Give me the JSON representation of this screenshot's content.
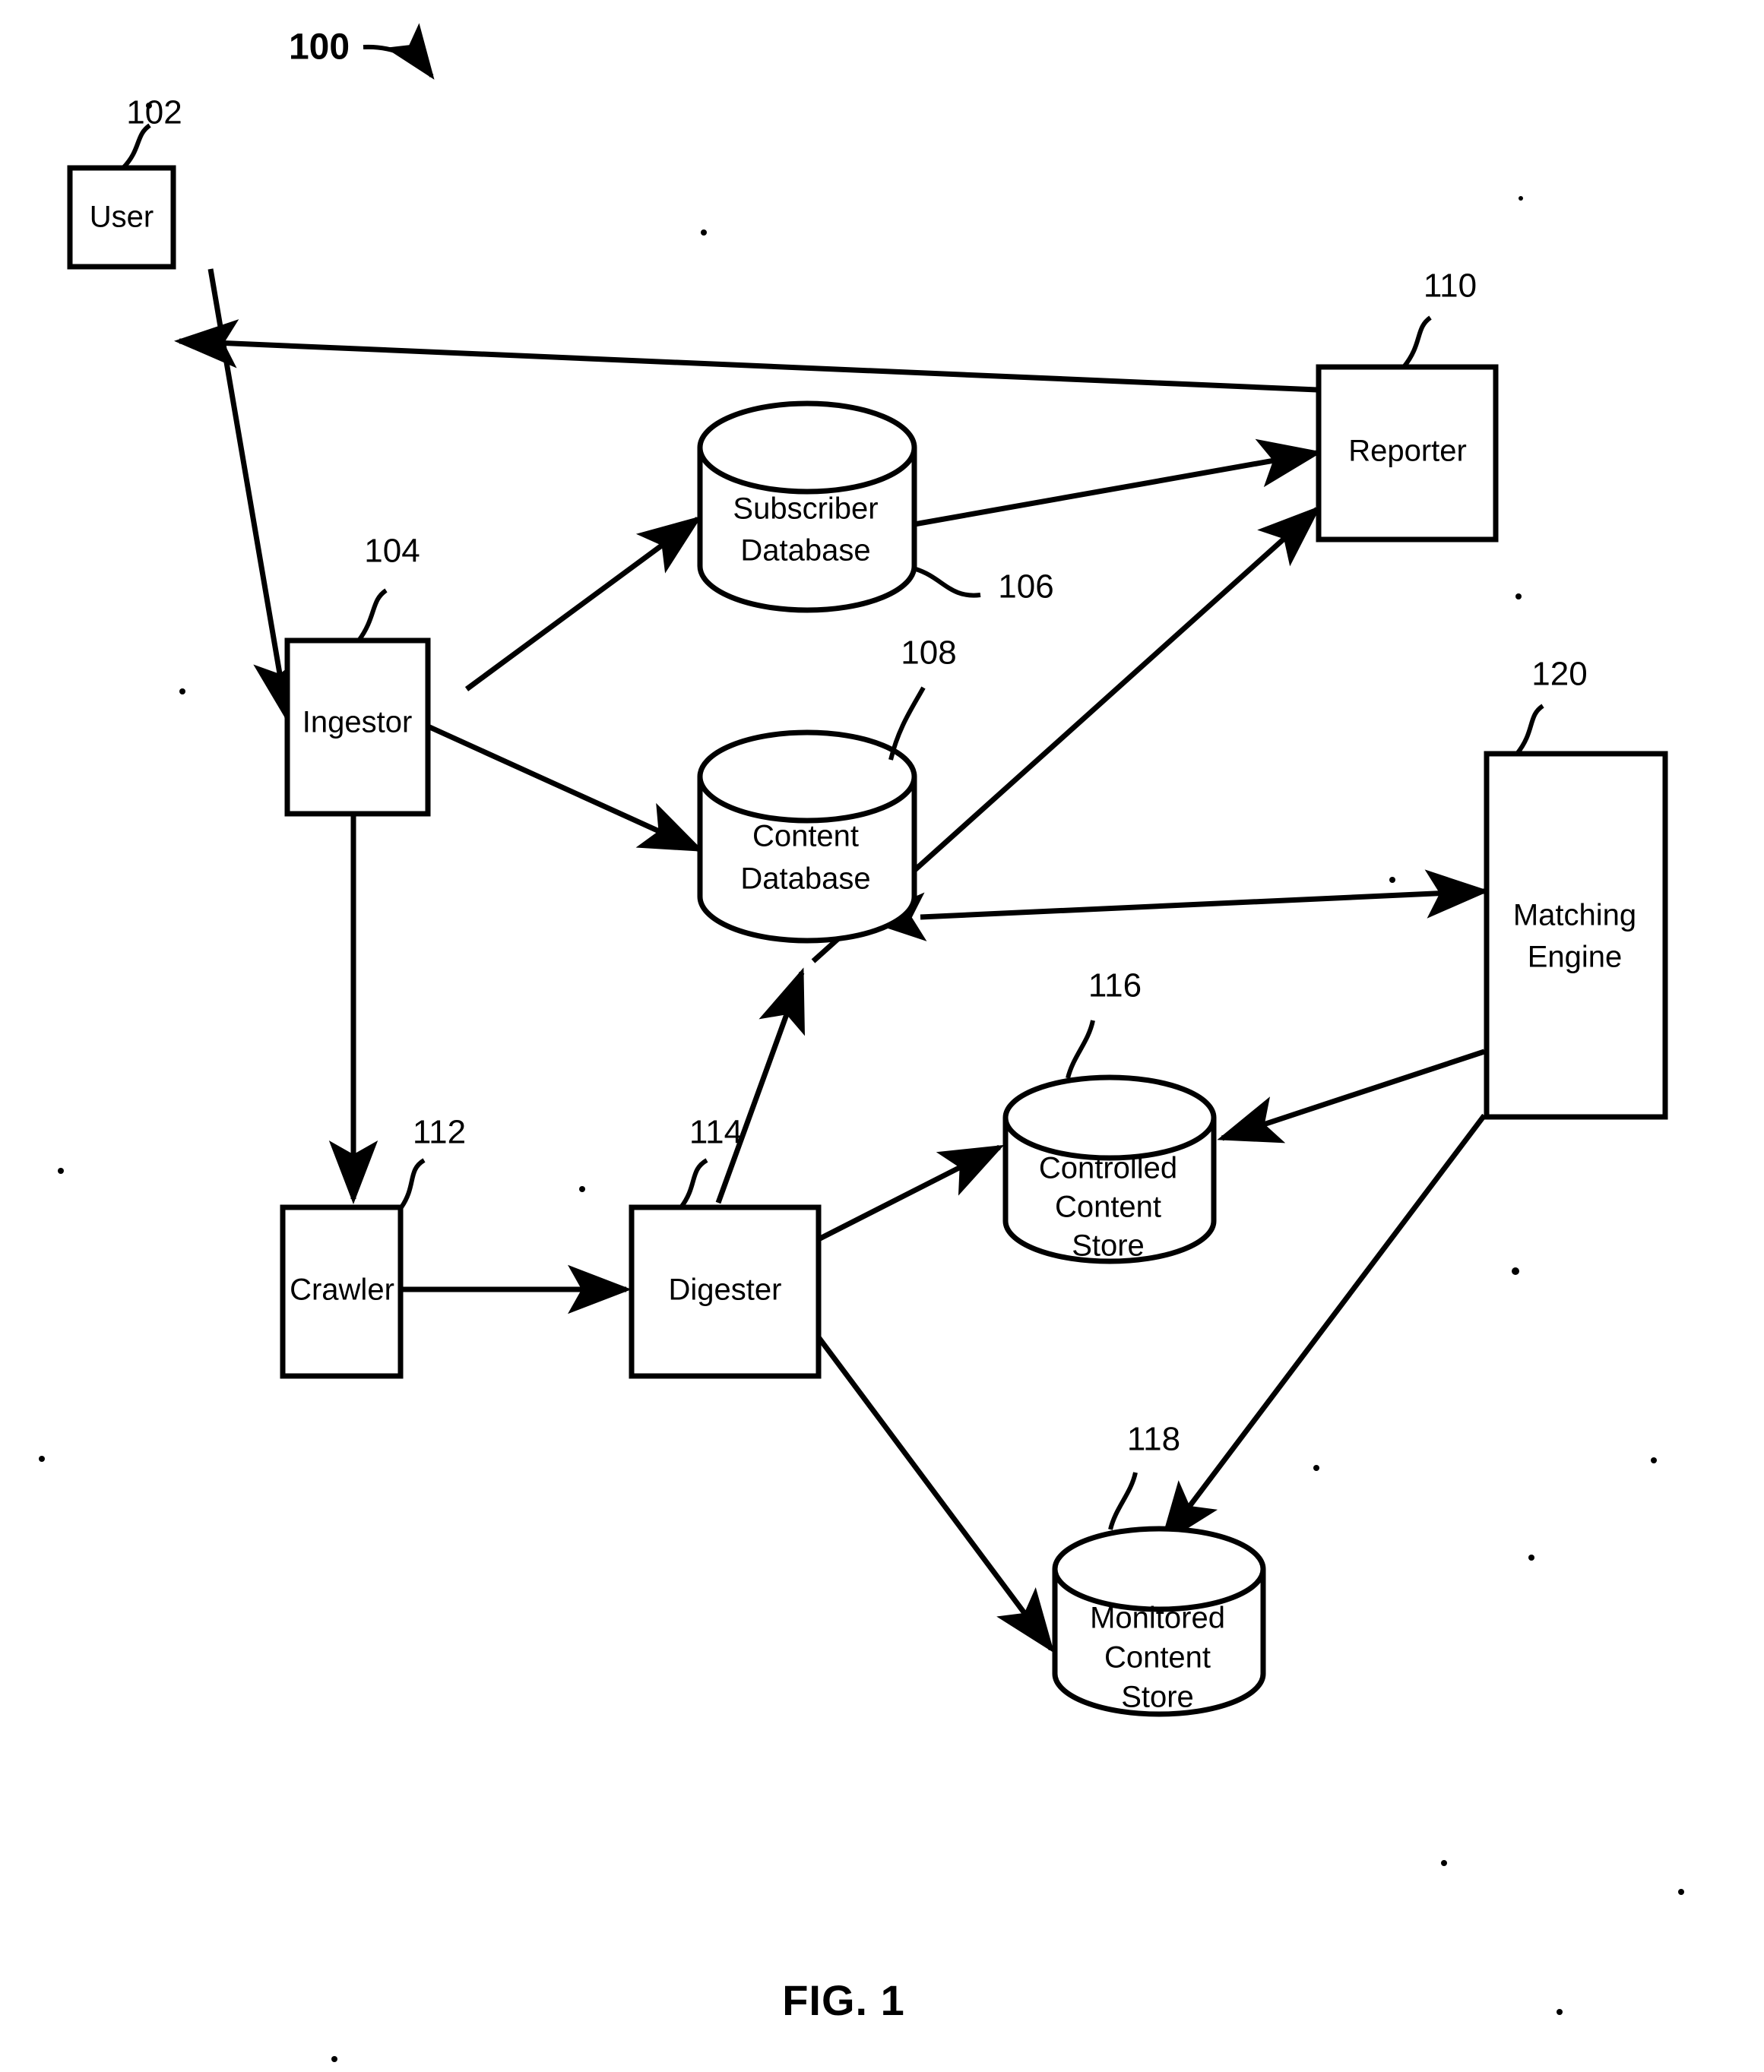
{
  "figure": {
    "caption": "FIG. 1",
    "system_reference": "100"
  },
  "nodes": [
    {
      "id": "user",
      "label": "User",
      "ref": "102",
      "shape": "box"
    },
    {
      "id": "ingestor",
      "label": "Ingestor",
      "ref": "104",
      "shape": "box"
    },
    {
      "id": "subscriber_db",
      "label_line1": "Subscriber",
      "label_line2": "Database",
      "ref": "106",
      "shape": "cylinder"
    },
    {
      "id": "content_db",
      "label_line1": "Content",
      "label_line2": "Database",
      "ref": "108",
      "shape": "cylinder"
    },
    {
      "id": "reporter",
      "label": "Reporter",
      "ref": "110",
      "shape": "box"
    },
    {
      "id": "crawler",
      "label": "Crawler",
      "ref": "112",
      "shape": "box"
    },
    {
      "id": "digester",
      "label": "Digester",
      "ref": "114",
      "shape": "box"
    },
    {
      "id": "controlled_store",
      "label_line1": "Controlled",
      "label_line2": "Content",
      "label_line3": "Store",
      "ref": "116",
      "shape": "cylinder"
    },
    {
      "id": "monitored_store",
      "label_line1": "Monitored",
      "label_line2": "Content",
      "label_line3": "Store",
      "ref": "118",
      "shape": "cylinder"
    },
    {
      "id": "matching_engine",
      "label_line1": "Matching",
      "label_line2": "Engine",
      "ref": "120",
      "shape": "box"
    }
  ],
  "connections": [
    {
      "from": "reporter",
      "to": "user",
      "direction": "one-way"
    },
    {
      "from": "user",
      "to": "ingestor",
      "direction": "one-way"
    },
    {
      "from": "ingestor",
      "to": "subscriber_db",
      "direction": "one-way"
    },
    {
      "from": "ingestor",
      "to": "content_db",
      "direction": "one-way"
    },
    {
      "from": "ingestor",
      "to": "crawler",
      "direction": "one-way"
    },
    {
      "from": "subscriber_db",
      "to": "reporter",
      "direction": "one-way"
    },
    {
      "from": "content_db",
      "to": "reporter",
      "direction": "one-way"
    },
    {
      "from": "content_db",
      "to": "matching_engine",
      "direction": "bidirectional"
    },
    {
      "from": "crawler",
      "to": "digester",
      "direction": "one-way"
    },
    {
      "from": "digester",
      "to": "content_db",
      "direction": "one-way"
    },
    {
      "from": "digester",
      "to": "controlled_store",
      "direction": "one-way"
    },
    {
      "from": "digester",
      "to": "monitored_store",
      "direction": "one-way"
    },
    {
      "from": "matching_engine",
      "to": "controlled_store",
      "direction": "one-way"
    },
    {
      "from": "matching_engine",
      "to": "monitored_store",
      "direction": "one-way"
    }
  ],
  "labels": {
    "user": "User",
    "ingestor": "Ingestor",
    "subscriber_db_1": "Subscriber",
    "subscriber_db_2": "Database",
    "content_db_1": "Content",
    "content_db_2": "Database",
    "reporter": "Reporter",
    "crawler": "Crawler",
    "digester": "Digester",
    "controlled_1": "Controlled",
    "controlled_2": "Content",
    "controlled_3": "Store",
    "monitored_1": "Monitored",
    "monitored_2": "Content",
    "monitored_3": "Store",
    "matching_1": "Matching",
    "matching_2": "Engine"
  },
  "refs": {
    "system": "100",
    "user": "102",
    "ingestor": "104",
    "subscriber_db": "106",
    "content_db": "108",
    "reporter": "110",
    "crawler": "112",
    "digester": "114",
    "controlled_store": "116",
    "monitored_store": "118",
    "matching_engine": "120"
  },
  "caption": {
    "text": "FIG. 1"
  }
}
